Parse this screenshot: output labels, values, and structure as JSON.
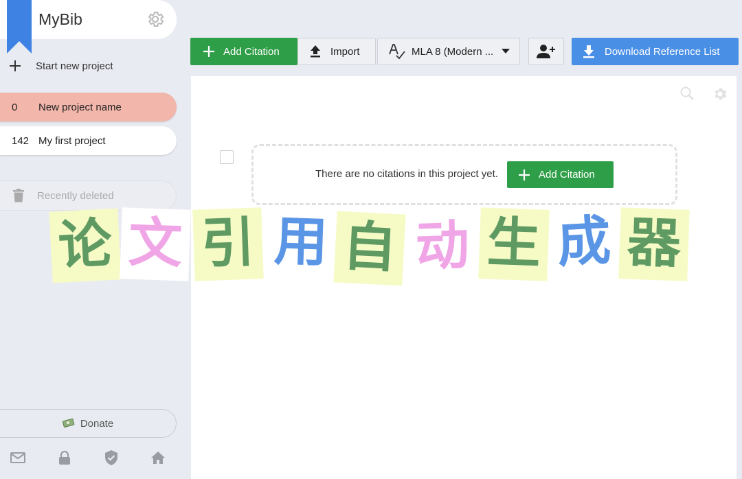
{
  "sidebar": {
    "app_title": "MyBib",
    "new_project_label": "Start new project",
    "projects": [
      {
        "count": "0",
        "name": "New project name",
        "active": true
      },
      {
        "count": "142",
        "name": "My first project",
        "active": false
      }
    ],
    "recently_deleted_label": "Recently deleted",
    "donate_label": "Donate",
    "footer_icons": [
      "mail-icon",
      "lock-icon",
      "shield-icon",
      "home-icon"
    ]
  },
  "toolbar": {
    "add_citation_label": "Add Citation",
    "import_label": "Import",
    "citation_style_label": "MLA 8 (Modern ...",
    "download_label": "Download Reference List"
  },
  "main": {
    "empty_message": "There are no citations in this project yet.",
    "add_citation_label": "Add Citation"
  },
  "overlay": {
    "characters": [
      "论",
      "文",
      "引",
      "用",
      "自",
      "动",
      "生",
      "成",
      "器"
    ]
  },
  "colors": {
    "accent_green": "#2f9e48",
    "accent_blue": "#4a8fe6",
    "active_project": "#f2b6ab",
    "bookmark_blue": "#3e82e4"
  }
}
